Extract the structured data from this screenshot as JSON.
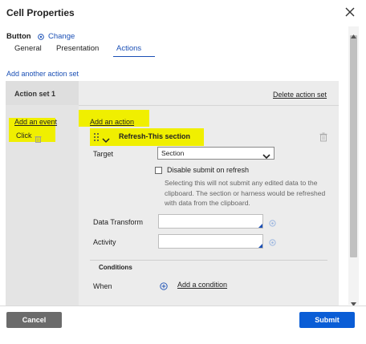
{
  "dialog": {
    "title": "Cell Properties"
  },
  "header": {
    "control_type": "Button",
    "change_label": "Change"
  },
  "tabs": [
    {
      "label": "General",
      "active": false
    },
    {
      "label": "Presentation",
      "active": false
    },
    {
      "label": "Actions",
      "active": true
    }
  ],
  "actions": {
    "add_action_set_label": "Add another action set",
    "action_set": {
      "title": "Action set 1",
      "delete_label": "Delete action set",
      "add_event_label": "Add an event",
      "event": "Click",
      "add_action_label": "Add an action",
      "action": {
        "title": "Refresh-This section",
        "target_label": "Target",
        "target_value": "Section",
        "disable_submit_label": "Disable submit on refresh",
        "disable_submit_checked": false,
        "disable_submit_note": "Selecting this will not submit any edited data to the clipboard. The section or harness would be refreshed with data from the clipboard.",
        "data_transform_label": "Data Transform",
        "data_transform_value": "",
        "activity_label": "Activity",
        "activity_value": ""
      },
      "conditions": {
        "header": "Conditions",
        "when_label": "When",
        "add_condition_label": "Add a condition"
      }
    }
  },
  "footer": {
    "cancel_label": "Cancel",
    "submit_label": "Submit"
  },
  "colors": {
    "link": "#1a4fb5",
    "highlight": "#f0ef00",
    "submit": "#0a5dd6",
    "cancel": "#6b6b6b"
  }
}
